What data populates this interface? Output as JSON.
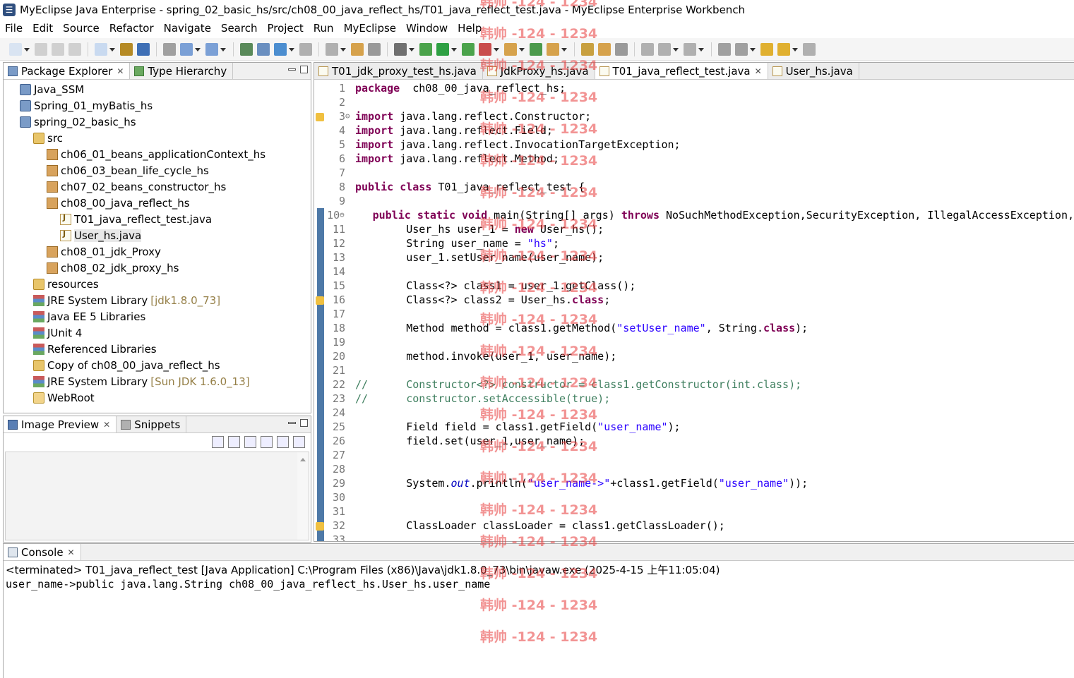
{
  "window": {
    "title": "MyEclipse Java Enterprise - spring_02_basic_hs/src/ch08_00_java_reflect_hs/T01_java_reflect_test.java - MyEclipse Enterprise Workbench"
  },
  "menu": [
    "File",
    "Edit",
    "Source",
    "Refactor",
    "Navigate",
    "Search",
    "Project",
    "Run",
    "MyEclipse",
    "Window",
    "Help"
  ],
  "left_panel": {
    "tabs": [
      {
        "label": "Package Explorer",
        "active": true,
        "closable": true
      },
      {
        "label": "Type Hierarchy",
        "active": false,
        "closable": false
      }
    ],
    "tree": [
      {
        "label": "Java_SSM",
        "icon": "project-icon",
        "extra": ""
      },
      {
        "label": "Spring_01_myBatis_hs",
        "icon": "project-icon",
        "extra": ""
      },
      {
        "label": "spring_02_basic_hs",
        "icon": "project-icon",
        "extra": ""
      },
      {
        "label": "src",
        "icon": "source-folder-icon",
        "extra": ""
      },
      {
        "label": "ch06_01_beans_applicationContext_hs",
        "icon": "package-icon",
        "extra": ""
      },
      {
        "label": "ch06_03_bean_life_cycle_hs",
        "icon": "package-icon",
        "extra": ""
      },
      {
        "label": "ch07_02_beans_constructor_hs",
        "icon": "package-icon",
        "extra": ""
      },
      {
        "label": "ch08_00_java_reflect_hs",
        "icon": "package-icon",
        "extra": ""
      },
      {
        "label": "T01_java_reflect_test.java",
        "icon": "java-file-icon",
        "extra": ""
      },
      {
        "label": "User_hs.java",
        "icon": "java-file-icon",
        "extra": ""
      },
      {
        "label": "ch08_01_jdk_Proxy",
        "icon": "package-icon",
        "extra": ""
      },
      {
        "label": "ch08_02_jdk_proxy_hs",
        "icon": "package-icon",
        "extra": ""
      },
      {
        "label": "resources",
        "icon": "source-folder-icon",
        "extra": ""
      },
      {
        "label": "JRE System Library",
        "icon": "library-icon",
        "extra": "[jdk1.8.0_73]"
      },
      {
        "label": "Java EE 5 Libraries",
        "icon": "library-icon",
        "extra": ""
      },
      {
        "label": "JUnit 4",
        "icon": "library-icon",
        "extra": ""
      },
      {
        "label": "Referenced Libraries",
        "icon": "library-icon",
        "extra": ""
      },
      {
        "label": "Copy of ch08_00_java_reflect_hs",
        "icon": "source-folder-icon",
        "extra": ""
      },
      {
        "label": "JRE System Library",
        "icon": "library-icon",
        "extra": "[Sun JDK 1.6.0_13]"
      },
      {
        "label": "WebRoot",
        "icon": "folder-icon",
        "extra": ""
      }
    ]
  },
  "bottom_left_panel": {
    "tabs": [
      {
        "label": "Image Preview",
        "active": true,
        "closable": true
      },
      {
        "label": "Snippets",
        "active": false,
        "closable": false
      }
    ]
  },
  "editor": {
    "tabs": [
      {
        "label": "T01_jdk_proxy_test_hs.java",
        "active": false,
        "closable": false
      },
      {
        "label": "JdkProxy_hs.java",
        "active": false,
        "closable": false
      },
      {
        "label": "T01_java_reflect_test.java",
        "active": true,
        "closable": true
      },
      {
        "label": "User_hs.java",
        "active": false,
        "closable": false
      }
    ],
    "lines": [
      {
        "n": "1",
        "fold": "",
        "parts": [
          [
            "kw",
            "package"
          ],
          [
            "",
            "  ch08_00_java_reflect_hs;"
          ]
        ]
      },
      {
        "n": "2",
        "fold": "",
        "parts": []
      },
      {
        "n": "3",
        "fold": "⊖",
        "parts": [
          [
            "kw",
            "import"
          ],
          [
            "",
            " java.lang.reflect.Constructor;"
          ]
        ]
      },
      {
        "n": "4",
        "fold": "",
        "parts": [
          [
            "kw",
            "import"
          ],
          [
            "",
            " java.lang.reflect.Field;"
          ]
        ]
      },
      {
        "n": "5",
        "fold": "",
        "parts": [
          [
            "kw",
            "import"
          ],
          [
            "",
            " java.lang.reflect.InvocationTargetException;"
          ]
        ]
      },
      {
        "n": "6",
        "fold": "",
        "parts": [
          [
            "kw",
            "import"
          ],
          [
            "",
            " java.lang.reflect.Method;"
          ]
        ]
      },
      {
        "n": "7",
        "fold": "",
        "parts": []
      },
      {
        "n": "8",
        "fold": "",
        "parts": [
          [
            "kw",
            "public"
          ],
          [
            "",
            " "
          ],
          [
            "kw",
            "class"
          ],
          [
            "",
            " T01_java_reflect_test {"
          ]
        ]
      },
      {
        "n": "9",
        "fold": "",
        "parts": []
      },
      {
        "n": "10",
        "fold": "⊖",
        "parts": [
          [
            "",
            "    "
          ],
          [
            "kw",
            "public"
          ],
          [
            "",
            " "
          ],
          [
            "kw",
            "static"
          ],
          [
            "",
            " "
          ],
          [
            "kw",
            "void"
          ],
          [
            "",
            " main(String[] args) "
          ],
          [
            "kw",
            "throws"
          ],
          [
            "",
            " NoSuchMethodException,SecurityException, IllegalAccessException,"
          ]
        ]
      },
      {
        "n": "11",
        "fold": "",
        "parts": [
          [
            "",
            "        User_hs user_1 = "
          ],
          [
            "kw",
            "new"
          ],
          [
            "",
            " User_hs();"
          ]
        ]
      },
      {
        "n": "12",
        "fold": "",
        "parts": [
          [
            "",
            "        String user_name = "
          ],
          [
            "str",
            "\"hs\""
          ],
          [
            "",
            ";"
          ]
        ]
      },
      {
        "n": "13",
        "fold": "",
        "parts": [
          [
            "",
            "        user_1.setUser_name(user_name);"
          ]
        ]
      },
      {
        "n": "14",
        "fold": "",
        "parts": []
      },
      {
        "n": "15",
        "fold": "",
        "parts": [
          [
            "",
            "        Class<?> class1 = user_1.getClass();"
          ]
        ]
      },
      {
        "n": "16",
        "fold": "",
        "parts": [
          [
            "",
            "        Class<?> class2 = User_hs."
          ],
          [
            "kw",
            "class"
          ],
          [
            "",
            ";"
          ]
        ]
      },
      {
        "n": "17",
        "fold": "",
        "parts": []
      },
      {
        "n": "18",
        "fold": "",
        "parts": [
          [
            "",
            "        Method method = class1.getMethod("
          ],
          [
            "str",
            "\"setUser_name\""
          ],
          [
            "",
            ", String."
          ],
          [
            "kw",
            "class"
          ],
          [
            "",
            ");"
          ]
        ]
      },
      {
        "n": "19",
        "fold": "",
        "parts": []
      },
      {
        "n": "20",
        "fold": "",
        "parts": [
          [
            "",
            "        method.invoke(user_1, user_name);"
          ]
        ]
      },
      {
        "n": "21",
        "fold": "",
        "parts": []
      },
      {
        "n": "22",
        "fold": "",
        "parts": [
          [
            "cmt",
            "//      Constructor<?> constructor = class1.getConstructor(int.class);"
          ]
        ]
      },
      {
        "n": "23",
        "fold": "",
        "parts": [
          [
            "cmt",
            "//      constructor.setAccessible(true);"
          ]
        ]
      },
      {
        "n": "24",
        "fold": "",
        "parts": []
      },
      {
        "n": "25",
        "fold": "",
        "parts": [
          [
            "",
            "        Field field = class1.getField("
          ],
          [
            "str",
            "\"user_name\""
          ],
          [
            "",
            ");"
          ]
        ]
      },
      {
        "n": "26",
        "fold": "",
        "parts": [
          [
            "",
            "        field.set(user_1,user_name);"
          ]
        ]
      },
      {
        "n": "27",
        "fold": "",
        "parts": []
      },
      {
        "n": "28",
        "fold": "",
        "parts": []
      },
      {
        "n": "29",
        "fold": "",
        "parts": [
          [
            "",
            "        System."
          ],
          [
            "ital",
            "out"
          ],
          [
            "",
            ".println("
          ],
          [
            "str",
            "\"user_name->\""
          ],
          [
            "",
            "+class1.getField("
          ],
          [
            "str",
            "\"user_name\""
          ],
          [
            "",
            "));"
          ]
        ]
      },
      {
        "n": "30",
        "fold": "",
        "parts": []
      },
      {
        "n": "31",
        "fold": "",
        "parts": []
      },
      {
        "n": "32",
        "fold": "",
        "parts": [
          [
            "",
            "        ClassLoader classLoader = class1.getClassLoader();"
          ]
        ]
      },
      {
        "n": "33",
        "fold": "",
        "parts": []
      }
    ]
  },
  "console": {
    "tab_label": "Console",
    "status": "<terminated> T01_java_reflect_test [Java Application] C:\\Program Files (x86)\\Java\\jdk1.8.0_73\\bin\\javaw.exe (2025-4-15 上午11:05:04)",
    "output": "user_name->public java.lang.String ch08_00_java_reflect_hs.User_hs.user_name"
  },
  "watermark_text": "韩帅 -124 - 1234",
  "colors": {
    "keyword": "#7f0055",
    "string": "#2a00ff",
    "comment": "#3f7f5f",
    "watermark": "#e83c3c"
  }
}
